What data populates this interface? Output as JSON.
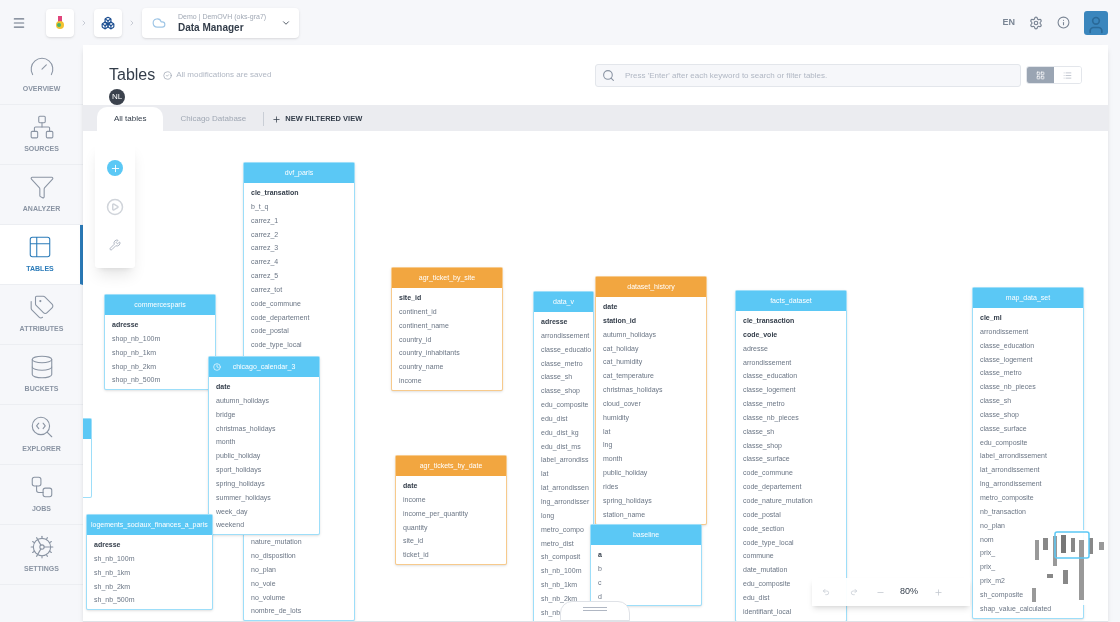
{
  "header": {
    "breadcrumb": {
      "subtitle": "Demo | DemOVH (oks-gra7)",
      "title": "Data Manager"
    },
    "language": "EN"
  },
  "sidebar": {
    "items": [
      {
        "label": "OVERVIEW",
        "selected": false
      },
      {
        "label": "SOURCES",
        "selected": false
      },
      {
        "label": "ANALYZER",
        "selected": false
      },
      {
        "label": "TABLES",
        "selected": true
      },
      {
        "label": "ATTRIBUTES",
        "selected": false
      },
      {
        "label": "BUCKETS",
        "selected": false
      },
      {
        "label": "EXPLORER",
        "selected": false
      },
      {
        "label": "JOBS",
        "selected": false
      },
      {
        "label": "SETTINGS",
        "selected": false
      }
    ]
  },
  "page": {
    "title": "Tables",
    "save_status": "All modifications are saved",
    "user_initials": "NL",
    "search": {
      "placeholder": "Press 'Enter' after each keyword to search or filter tables."
    },
    "views": [
      {
        "kind": "grid",
        "selected": true
      },
      {
        "kind": "list",
        "selected": false
      }
    ]
  },
  "tabs": [
    {
      "label": "All tables",
      "selected": true
    },
    {
      "label": "Chicago Database",
      "selected": false
    }
  ],
  "new_view_button": "NEW FILTERED VIEW",
  "tables": [
    {
      "name": "dvf_paris",
      "color": "#5bc8f5",
      "scheduled": false,
      "rows": [
        {
          "name": "cle_transation",
          "key": true
        },
        {
          "name": "b_t_q",
          "key": false
        },
        {
          "name": "carrez_1",
          "key": false
        },
        {
          "name": "carrez_2",
          "key": false
        },
        {
          "name": "carrez_3",
          "key": false
        },
        {
          "name": "carrez_4",
          "key": false
        },
        {
          "name": "carrez_5",
          "key": false
        },
        {
          "name": "carrez_tot",
          "key": false
        },
        {
          "name": "code_commune",
          "key": false
        },
        {
          "name": "code_departement",
          "key": false
        },
        {
          "name": "code_postal",
          "key": false
        },
        {
          "name": "code_type_local",
          "key": false
        }
      ],
      "rows_below": [
        {
          "name": "nature_mutation",
          "key": false
        },
        {
          "name": "no_disposition",
          "key": false
        },
        {
          "name": "no_plan",
          "key": false
        },
        {
          "name": "no_voie",
          "key": false
        },
        {
          "name": "no_volume",
          "key": false
        },
        {
          "name": "nombre_de_lots",
          "key": false
        }
      ]
    },
    {
      "name": "commercesparis",
      "color": "#5bc8f5",
      "scheduled": false,
      "rows": [
        {
          "name": "adresse",
          "key": true
        },
        {
          "name": "shop_nb_100m",
          "key": false
        },
        {
          "name": "shop_nb_1km",
          "key": false
        },
        {
          "name": "shop_nb_2km",
          "key": false
        },
        {
          "name": "shop_nb_500m",
          "key": false
        }
      ]
    },
    {
      "name": "chicago_calendar_3",
      "color": "#5bc8f5",
      "scheduled": true,
      "rows": [
        {
          "name": "date",
          "key": true
        },
        {
          "name": "autumn_holidays",
          "key": false
        },
        {
          "name": "bridge",
          "key": false
        },
        {
          "name": "christmas_holidays",
          "key": false
        },
        {
          "name": "month",
          "key": false
        },
        {
          "name": "public_holiday",
          "key": false
        },
        {
          "name": "sport_holidays",
          "key": false
        },
        {
          "name": "spring_holidays",
          "key": false
        },
        {
          "name": "summer_holidays",
          "key": false
        },
        {
          "name": "week_day",
          "key": false
        },
        {
          "name": "weekend",
          "key": false
        }
      ]
    },
    {
      "name": "logements_sociaux_finances_a_paris",
      "color": "#5bc8f5",
      "scheduled": false,
      "rows": [
        {
          "name": "adresse",
          "key": true
        },
        {
          "name": "sh_nb_100m",
          "key": false
        },
        {
          "name": "sh_nb_1km",
          "key": false
        },
        {
          "name": "sh_nb_2km",
          "key": false
        },
        {
          "name": "sh_nb_500m",
          "key": false
        }
      ]
    },
    {
      "name": "agr_ticket_by_site",
      "color": "#f2a640",
      "scheduled": false,
      "rows": [
        {
          "name": "site_id",
          "key": true
        },
        {
          "name": "continent_id",
          "key": false
        },
        {
          "name": "continent_name",
          "key": false
        },
        {
          "name": "country_id",
          "key": false
        },
        {
          "name": "country_inhabitants",
          "key": false
        },
        {
          "name": "country_name",
          "key": false
        },
        {
          "name": "income",
          "key": false
        }
      ]
    },
    {
      "name": "agr_tickets_by_date",
      "color": "#f2a640",
      "scheduled": false,
      "rows": [
        {
          "name": "date",
          "key": true
        },
        {
          "name": "income",
          "key": false
        },
        {
          "name": "income_per_quantity",
          "key": false
        },
        {
          "name": "quantity",
          "key": false
        },
        {
          "name": "site_id",
          "key": false
        },
        {
          "name": "ticket_id",
          "key": false
        }
      ]
    },
    {
      "name": "data_v",
      "color": "#5bc8f5",
      "scheduled": false,
      "rows": [
        {
          "name": "adresse",
          "key": true
        },
        {
          "name": "arrondissement",
          "key": false
        },
        {
          "name": "classe_educatio",
          "key": false
        },
        {
          "name": "classe_metro",
          "key": false
        },
        {
          "name": "classe_sh",
          "key": false
        },
        {
          "name": "classe_shop",
          "key": false
        },
        {
          "name": "edu_composite",
          "key": false
        },
        {
          "name": "edu_dist",
          "key": false
        },
        {
          "name": "edu_dist_kg",
          "key": false
        },
        {
          "name": "edu_dist_ms",
          "key": false
        },
        {
          "name": "label_arrondiss",
          "key": false
        },
        {
          "name": "lat",
          "key": false
        },
        {
          "name": "lat_arrondissen",
          "key": false
        },
        {
          "name": "lng_arrondisser",
          "key": false
        },
        {
          "name": "long",
          "key": false
        },
        {
          "name": "metro_compo",
          "key": false
        },
        {
          "name": "metro_dist",
          "key": false
        },
        {
          "name": "sh_composit",
          "key": false
        },
        {
          "name": "sh_nb_100m",
          "key": false
        },
        {
          "name": "sh_nb_1km",
          "key": false
        },
        {
          "name": "sh_nb_2km",
          "key": false
        },
        {
          "name": "sh_nb",
          "key": false
        }
      ]
    },
    {
      "name": "dataset_history",
      "color": "#f2a640",
      "scheduled": false,
      "rows": [
        {
          "name": "date",
          "key": true
        },
        {
          "name": "station_id",
          "key": true
        },
        {
          "name": "autumn_holidays",
          "key": false
        },
        {
          "name": "cat_holiday",
          "key": false
        },
        {
          "name": "cat_humidity",
          "key": false
        },
        {
          "name": "cat_temperature",
          "key": false
        },
        {
          "name": "christmas_holidays",
          "key": false
        },
        {
          "name": "cloud_cover",
          "key": false
        },
        {
          "name": "humidity",
          "key": false
        },
        {
          "name": "lat",
          "key": false
        },
        {
          "name": "lng",
          "key": false
        },
        {
          "name": "month",
          "key": false
        },
        {
          "name": "public_holiday",
          "key": false
        },
        {
          "name": "rides",
          "key": false
        },
        {
          "name": "spring_holidays",
          "key": false
        },
        {
          "name": "station_name",
          "key": false
        }
      ]
    },
    {
      "name": "baseline",
      "color": "#5bc8f5",
      "scheduled": false,
      "rows": [
        {
          "name": "a",
          "key": true
        },
        {
          "name": "b",
          "key": false
        },
        {
          "name": "c",
          "key": false
        },
        {
          "name": "d",
          "key": false
        }
      ]
    },
    {
      "name": "facts_dataset",
      "color": "#5bc8f5",
      "scheduled": false,
      "rows": [
        {
          "name": "cle_transaction",
          "key": true
        },
        {
          "name": "code_voie",
          "key": true
        },
        {
          "name": "adresse",
          "key": false
        },
        {
          "name": "arrondissement",
          "key": false
        },
        {
          "name": "classe_education",
          "key": false
        },
        {
          "name": "classe_logement",
          "key": false
        },
        {
          "name": "classe_metro",
          "key": false
        },
        {
          "name": "classe_nb_pieces",
          "key": false
        },
        {
          "name": "classe_sh",
          "key": false
        },
        {
          "name": "classe_shop",
          "key": false
        },
        {
          "name": "classe_surface",
          "key": false
        },
        {
          "name": "code_commune",
          "key": false
        },
        {
          "name": "code_departement",
          "key": false
        },
        {
          "name": "code_nature_mutation",
          "key": false
        },
        {
          "name": "code_postal",
          "key": false
        },
        {
          "name": "code_section",
          "key": false
        },
        {
          "name": "code_type_local",
          "key": false
        },
        {
          "name": "commune",
          "key": false
        },
        {
          "name": "date_mutation",
          "key": false
        },
        {
          "name": "edu_composite",
          "key": false
        },
        {
          "name": "edu_dist",
          "key": false
        },
        {
          "name": "identifiant_local",
          "key": false
        }
      ]
    },
    {
      "name": "map_data_set",
      "color": "#5bc8f5",
      "scheduled": false,
      "rows": [
        {
          "name": "cle_ml",
          "key": true
        },
        {
          "name": "arrondissement",
          "key": false
        },
        {
          "name": "classe_education",
          "key": false
        },
        {
          "name": "classe_logement",
          "key": false
        },
        {
          "name": "classe_metro",
          "key": false
        },
        {
          "name": "classe_nb_pieces",
          "key": false
        },
        {
          "name": "classe_sh",
          "key": false
        },
        {
          "name": "classe_shop",
          "key": false
        },
        {
          "name": "classe_surface",
          "key": false
        },
        {
          "name": "edu_composite",
          "key": false
        },
        {
          "name": "label_arrondissement",
          "key": false
        },
        {
          "name": "lat_arrondissement",
          "key": false
        },
        {
          "name": "lng_arrondissement",
          "key": false
        },
        {
          "name": "metro_composite",
          "key": false
        },
        {
          "name": "nb_transaction",
          "key": false
        },
        {
          "name": "no_plan",
          "key": false
        },
        {
          "name": "nom",
          "key": false
        },
        {
          "name": "prix_",
          "key": false
        },
        {
          "name": "prix_",
          "key": false
        },
        {
          "name": "prix_m2",
          "key": false
        },
        {
          "name": "sh_composite",
          "key": false
        },
        {
          "name": "shap_value_calculated",
          "key": false
        }
      ]
    }
  ],
  "zoom": {
    "level_text": "80%"
  }
}
